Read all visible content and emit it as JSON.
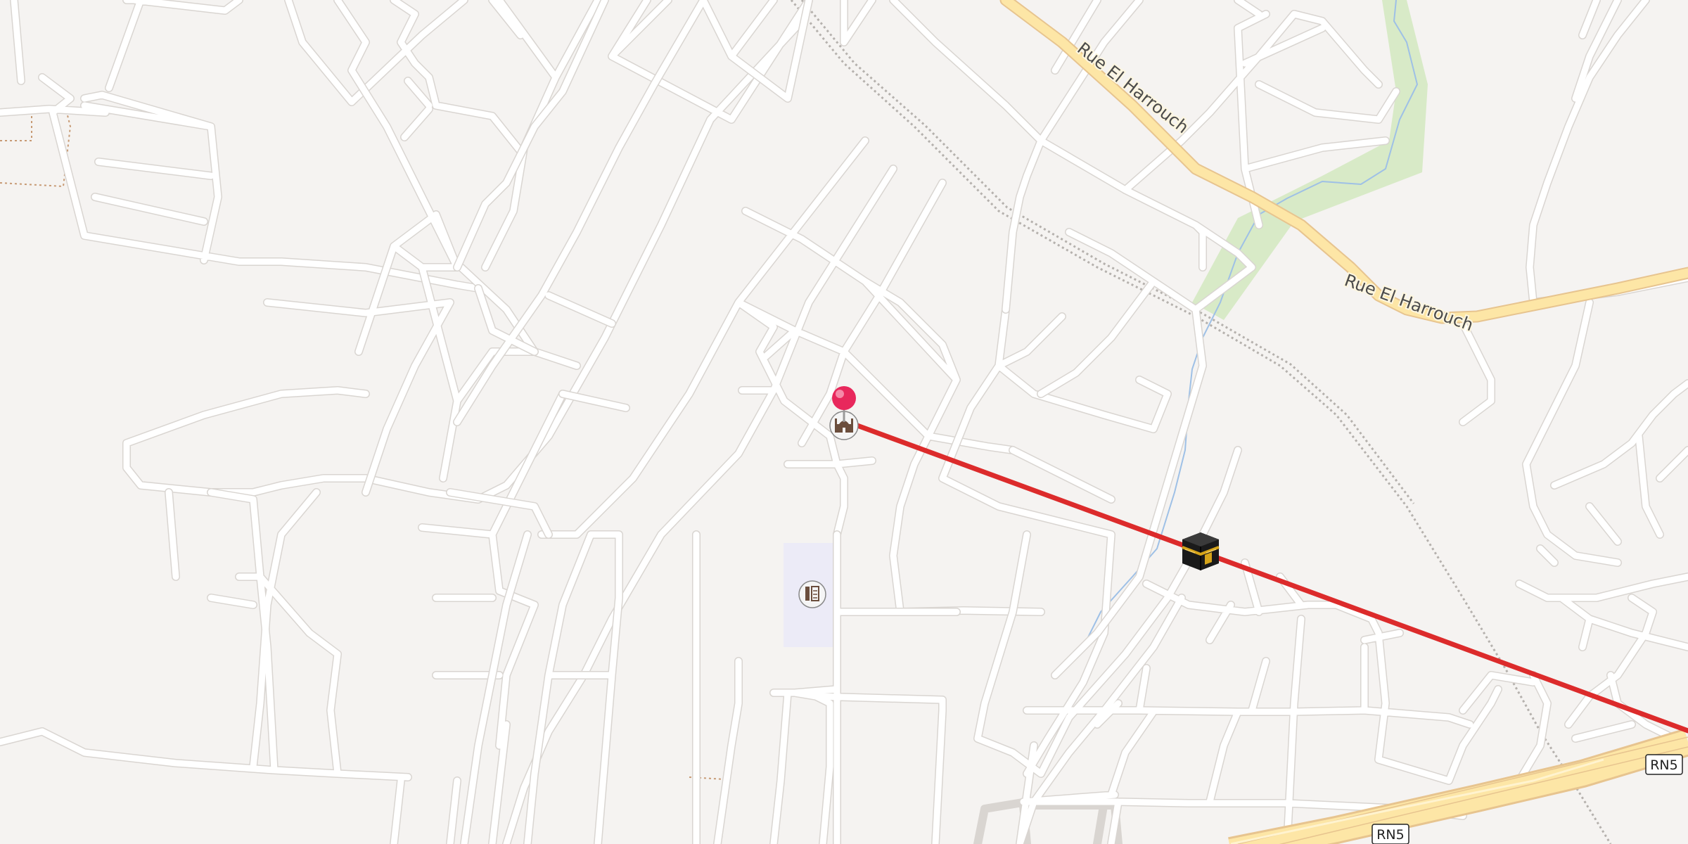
{
  "map": {
    "road_labels": [
      {
        "id": "rue-el-harrouch-north",
        "text": "Rue El Harrouch"
      },
      {
        "id": "rue-el-harrouch-east",
        "text": "Rue El Harrouch"
      }
    ],
    "route_shields": [
      "RN5",
      "RN5"
    ],
    "markers": {
      "location_pin": {
        "color": "#e8285c",
        "icon": "map-pin"
      },
      "mosque_poi": {
        "icon": "mosque-icon"
      },
      "school_poi": {
        "icon": "school-icon"
      },
      "qibla_target": {
        "icon": "kaaba-icon"
      }
    },
    "direction_line": {
      "color": "#dc2b2b"
    },
    "colors": {
      "background": "#f5f3f1",
      "street": "#ffffff",
      "primary_road": "#fde6a6",
      "park": "#d8eac7",
      "school_area": "#ecebf7",
      "water": "#9ec0e6"
    }
  }
}
